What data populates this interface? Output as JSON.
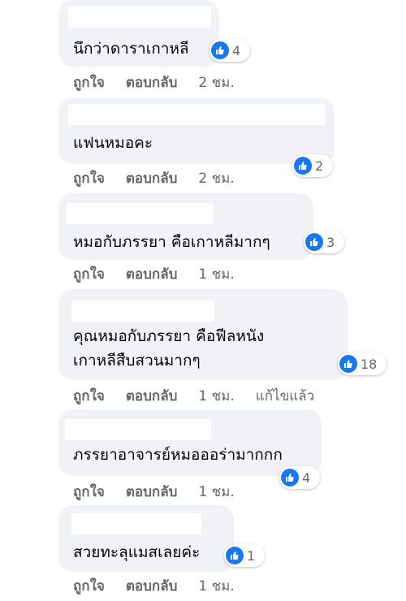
{
  "colors": {
    "bubble_bg": "#f0f2f5",
    "like_blue": "#1877f2",
    "meta_text": "#65676b"
  },
  "comments": [
    {
      "text_lines": [
        "นึกว่าดาราเกาหลี"
      ],
      "like_label": "ถูกใจ",
      "reply_label": "ตอบกลับ",
      "time": "2 ชม.",
      "reaction_icon": "thumbs-up-icon",
      "reaction_count": "4"
    },
    {
      "text_lines": [
        "แฟนหมอคะ"
      ],
      "like_label": "ถูกใจ",
      "reply_label": "ตอบกลับ",
      "time": "2 ชม.",
      "reaction_icon": "thumbs-up-icon",
      "reaction_count": "2"
    },
    {
      "text_lines": [
        "หมอกับภรรยา คือเกาหลีมากๆ"
      ],
      "like_label": "ถูกใจ",
      "reply_label": "ตอบกลับ",
      "time": "1 ชม.",
      "reaction_icon": "thumbs-up-icon",
      "reaction_count": "3"
    },
    {
      "text_lines": [
        "คุณหมอกับภรรยา คือฟีลหนัง",
        "เกาหลีสืบสวนมากๆ"
      ],
      "like_label": "ถูกใจ",
      "reply_label": "ตอบกลับ",
      "time": "1 ชม.",
      "edited_label": "แก้ไขแล้ว",
      "reaction_icon": "thumbs-up-icon",
      "reaction_count": "18"
    },
    {
      "text_lines": [
        "ภรรยาอาจารย์หมอออร่ามากกก"
      ],
      "like_label": "ถูกใจ",
      "reply_label": "ตอบกลับ",
      "time": "1 ชม.",
      "reaction_icon": "thumbs-up-icon",
      "reaction_count": "4"
    },
    {
      "text_lines": [
        "สวยทะลุแมสเลยค่ะ"
      ],
      "like_label": "ถูกใจ",
      "reply_label": "ตอบกลับ",
      "time": "1 ชม.",
      "reaction_icon": "thumbs-up-icon",
      "reaction_count": "1"
    }
  ]
}
